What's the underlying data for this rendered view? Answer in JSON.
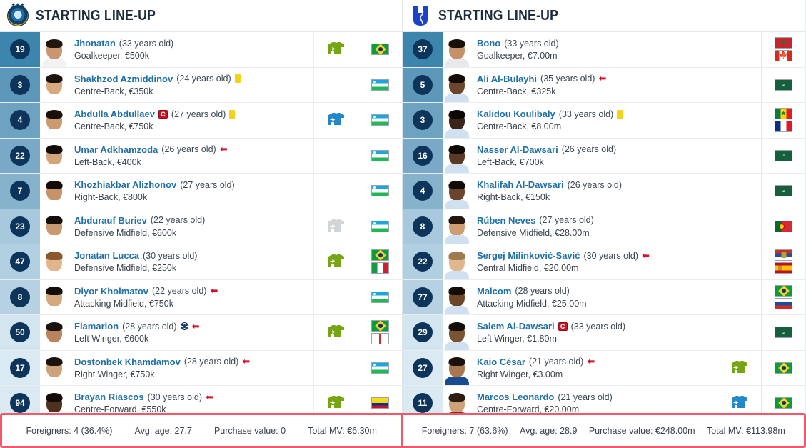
{
  "left": {
    "title": "STARTING LINE-UP",
    "crest": "pakhtakor-crest",
    "players": [
      {
        "number": "19",
        "name": "Jhonatan",
        "age": "(33 years old)",
        "pos": "Goalkeeper, €500k",
        "card": null,
        "captain": false,
        "goal": false,
        "subOff": false,
        "jersey": "green",
        "flags": [
          "br"
        ],
        "shade": "#3c86ae",
        "skin": "#c99672",
        "hair": "#23160e",
        "kit": "#f2f2f2"
      },
      {
        "number": "3",
        "name": "Shakhzod Azmiddinov",
        "age": "(24 years old)",
        "pos": "Centre-Back, €350k",
        "card": "yellow",
        "captain": false,
        "goal": false,
        "subOff": false,
        "jersey": null,
        "flags": [
          "uz"
        ],
        "shade": "#5d98ba",
        "skin": "#d6a97f",
        "hair": "#1b1209",
        "kit": "#ffffff"
      },
      {
        "number": "4",
        "name": "Abdulla Abdullaev",
        "age": "(27 years old)",
        "pos": "Centre-Back, €750k",
        "card": "yellow",
        "captain": true,
        "goal": false,
        "subOff": false,
        "jersey": "blue",
        "flags": [
          "uz"
        ],
        "shade": "#6ea2c1",
        "skin": "#cb9a70",
        "hair": "#181009",
        "kit": "#ffffff"
      },
      {
        "number": "22",
        "name": "Umar Adkhamzoda",
        "age": "(26 years old)",
        "pos": "Left-Back, €400k",
        "card": null,
        "captain": false,
        "goal": false,
        "subOff": true,
        "jersey": null,
        "flags": [
          "uz"
        ],
        "shade": "#79a9c6",
        "skin": "#d2a47a",
        "hair": "#140d07",
        "kit": "#ffffff"
      },
      {
        "number": "7",
        "name": "Khozhiakbar Alizhonov",
        "age": "(27 years old)",
        "pos": "Right-Back, €800k",
        "card": null,
        "captain": false,
        "goal": false,
        "subOff": false,
        "jersey": null,
        "flags": [
          "uz"
        ],
        "shade": "#86b2cc",
        "skin": "#c69268",
        "hair": "#120b06",
        "kit": "#ffffff"
      },
      {
        "number": "23",
        "name": "Abdurauf Buriev",
        "age": "(22 years old)",
        "pos": "Defensive Midfield, €600k",
        "card": null,
        "captain": false,
        "goal": false,
        "subOff": false,
        "jersey": "grey",
        "flags": [
          "uz"
        ],
        "shade": "#a8c9dd",
        "skin": "#c99a72",
        "hair": "#160e08",
        "kit": "#ffffff"
      },
      {
        "number": "47",
        "name": "Jonatan Lucca",
        "age": "(30 years old)",
        "pos": "Defensive Midfield, €250k",
        "card": null,
        "captain": false,
        "goal": false,
        "subOff": false,
        "jersey": "green",
        "flags": [
          "br",
          "it"
        ],
        "shade": "#b0cfe0",
        "skin": "#e2b68d",
        "hair": "#8a5a2c",
        "kit": "#ffffff"
      },
      {
        "number": "8",
        "name": "Diyor Kholmatov",
        "age": "(22 years old)",
        "pos": "Attacking Midfield, €750k",
        "card": null,
        "captain": false,
        "goal": false,
        "subOff": true,
        "jersey": null,
        "flags": [
          "uz"
        ],
        "shade": "#b6d2e2",
        "skin": "#d3a87e",
        "hair": "#140d07",
        "kit": "#ffffff"
      },
      {
        "number": "50",
        "name": "Flamarion",
        "age": "(28 years old)",
        "pos": "Left Winger, €600k",
        "card": null,
        "captain": false,
        "goal": true,
        "subOff": true,
        "jersey": "green",
        "flags": [
          "br",
          "ge"
        ],
        "shade": "#d3e5ef",
        "skin": "#b9845c",
        "hair": "#1a110a",
        "kit": "#ffffff"
      },
      {
        "number": "17",
        "name": "Dostonbek Khamdamov",
        "age": "(28 years old)",
        "pos": "Right Winger, €750k",
        "card": null,
        "captain": false,
        "goal": false,
        "subOff": true,
        "jersey": null,
        "flags": [
          "uz"
        ],
        "shade": "#dbeaf2",
        "skin": "#cfa179",
        "hair": "#1d130b",
        "kit": "#ffffff"
      },
      {
        "number": "94",
        "name": "Brayan Riascos",
        "age": "(30 years old)",
        "pos": "Centre-Forward, €550k",
        "card": null,
        "captain": false,
        "goal": false,
        "subOff": true,
        "jersey": "green",
        "flags": [
          "co"
        ],
        "shade": "#dbeaf2",
        "skin": "#4d3220",
        "hair": "#120b06",
        "kit": "#ffffff"
      }
    ],
    "stats": {
      "foreigners": "Foreigners: 4 (36.4%)",
      "avg_age": "Avg. age: 27.7",
      "purchase_value": "Purchase value: 0",
      "total_mv": "Total MV: €6.30m"
    }
  },
  "right": {
    "title": "STARTING LINE-UP",
    "crest": "alhilal-crest",
    "players": [
      {
        "number": "37",
        "name": "Bono",
        "age": "(33 years old)",
        "pos": "Goalkeeper, €7.00m",
        "card": null,
        "captain": false,
        "goal": false,
        "subOff": false,
        "jersey": null,
        "flags": [
          "ma",
          "ca"
        ],
        "shade": "#3c86ae",
        "skin": "#c4916a",
        "hair": "#191009",
        "kit": "#e9e9e9"
      },
      {
        "number": "5",
        "name": "Ali Al-Bulayhi",
        "age": "(35 years old)",
        "pos": "Centre-Back, €325k",
        "card": null,
        "captain": false,
        "goal": false,
        "subOff": true,
        "jersey": null,
        "flags": [
          "sa"
        ],
        "shade": "#5d98ba",
        "skin": "#6b462c",
        "hair": "#120b06",
        "kit": "#cfe0f0"
      },
      {
        "number": "3",
        "name": "Kalidou Koulibaly",
        "age": "(33 years old)",
        "pos": "Centre-Back, €8.00m",
        "card": "yellow",
        "captain": false,
        "goal": false,
        "subOff": false,
        "jersey": null,
        "flags": [
          "sn",
          "fr"
        ],
        "shade": "#6ea2c1",
        "skin": "#3a2518",
        "hair": "#0d0805",
        "kit": "#cfe0f0"
      },
      {
        "number": "16",
        "name": "Nasser Al-Dawsari",
        "age": "(26 years old)",
        "pos": "Left-Back, €700k",
        "card": null,
        "captain": false,
        "goal": false,
        "subOff": false,
        "jersey": null,
        "flags": [
          "sa"
        ],
        "shade": "#79a9c6",
        "skin": "#5a3a24",
        "hair": "#100a06",
        "kit": "#cfe0f0"
      },
      {
        "number": "4",
        "name": "Khalifah Al-Dawsari",
        "age": "(26 years old)",
        "pos": "Right-Back, €150k",
        "card": null,
        "captain": false,
        "goal": false,
        "subOff": false,
        "jersey": null,
        "flags": [
          "sa"
        ],
        "shade": "#86b2cc",
        "skin": "#6a452c",
        "hair": "#120b07",
        "kit": "#cfe0f0"
      },
      {
        "number": "8",
        "name": "Rúben Neves",
        "age": "(27 years old)",
        "pos": "Defensive Midfield, €28.00m",
        "card": null,
        "captain": false,
        "goal": false,
        "subOff": false,
        "jersey": null,
        "flags": [
          "pt"
        ],
        "shade": "#a8c9dd",
        "skin": "#cf9d72",
        "hair": "#231710",
        "kit": "#cfe0f0"
      },
      {
        "number": "22",
        "name": "Sergej Milinković-Savić",
        "age": "(30 years old)",
        "pos": "Central Midfield, €20.00m",
        "card": null,
        "captain": false,
        "goal": false,
        "subOff": true,
        "jersey": null,
        "flags": [
          "rs",
          "es"
        ],
        "shade": "#b0cfe0",
        "skin": "#e0b68f",
        "hair": "#9d7a4e",
        "kit": "#cfe0f0"
      },
      {
        "number": "77",
        "name": "Malcom",
        "age": "(28 years old)",
        "pos": "Attacking Midfield, €25.00m",
        "card": null,
        "captain": false,
        "goal": false,
        "subOff": false,
        "jersey": null,
        "flags": [
          "br",
          "ru"
        ],
        "shade": "#b6d2e2",
        "skin": "#6d4529",
        "hair": "#130c07",
        "kit": "#cfe0f0"
      },
      {
        "number": "29",
        "name": "Salem Al-Dawsari",
        "age": "(33 years old)",
        "pos": "Left Winger, €1.80m",
        "card": null,
        "captain": true,
        "goal": false,
        "subOff": false,
        "jersey": null,
        "flags": [
          "sa"
        ],
        "shade": "#d3e5ef",
        "skin": "#7a5234",
        "hair": "#150d08",
        "kit": "#cfe0f0"
      },
      {
        "number": "27",
        "name": "Kaio César",
        "age": "(21 years old)",
        "pos": "Right Winger, €3.00m",
        "card": null,
        "captain": false,
        "goal": false,
        "subOff": true,
        "jersey": "green",
        "flags": [
          "br"
        ],
        "shade": "#dbeaf2",
        "skin": "#a9764f",
        "hair": "#1a110a",
        "kit": "#1b4b8f"
      },
      {
        "number": "11",
        "name": "Marcos Leonardo",
        "age": "(21 years old)",
        "pos": "Centre-Forward, €20.00m",
        "card": null,
        "captain": false,
        "goal": false,
        "subOff": false,
        "jersey": "blue",
        "flags": [
          "br"
        ],
        "shade": "#dbeaf2",
        "skin": "#cda279",
        "hair": "#2d1c10",
        "kit": "#8d2b2b"
      }
    ],
    "stats": {
      "foreigners": "Foreigners: 7 (63.6%)",
      "avg_age": "Avg. age: 28.9",
      "purchase_value": "Purchase value: €248.00m",
      "total_mv": "Total MV: €113.98m"
    }
  },
  "colors": {
    "accent_red": "#f2586a",
    "link_blue": "#1f6fa8",
    "badge_navy": "#0d355c",
    "jersey_green": "#76a514",
    "jersey_blue": "#2387c8",
    "jersey_grey": "#d2d5d7"
  }
}
